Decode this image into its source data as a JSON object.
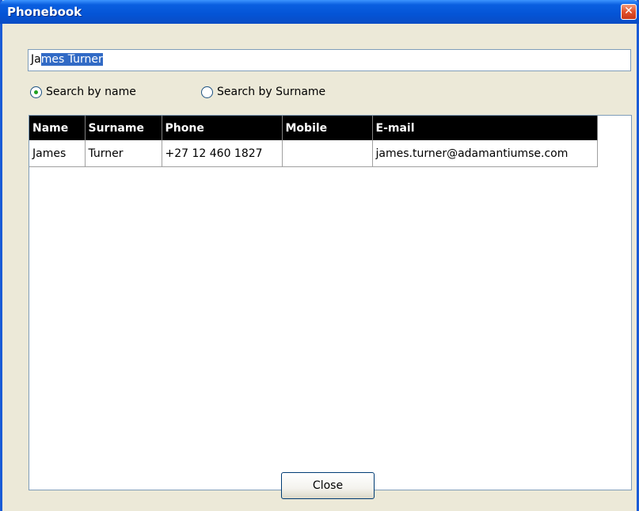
{
  "window": {
    "title": "Phonebook",
    "close_icon": "close-icon"
  },
  "search": {
    "value_prefix": "Ja",
    "value_selected": "mes Turner"
  },
  "radios": [
    {
      "label": "Search by name",
      "selected": true
    },
    {
      "label": "Search by Surname",
      "selected": false
    }
  ],
  "table": {
    "columns": [
      "Name",
      "Surname",
      "Phone",
      "Mobile",
      "E-mail"
    ],
    "rows": [
      [
        "James",
        "Turner",
        "+27 12 460 1827",
        "",
        "james.turner@adamantiumse.com"
      ]
    ]
  },
  "buttons": {
    "close_label": "Close"
  },
  "colors": {
    "titlebar": "#0454d6",
    "window_bg": "#ece9d8",
    "selection": "#316ac5",
    "header_bg": "#000000"
  }
}
